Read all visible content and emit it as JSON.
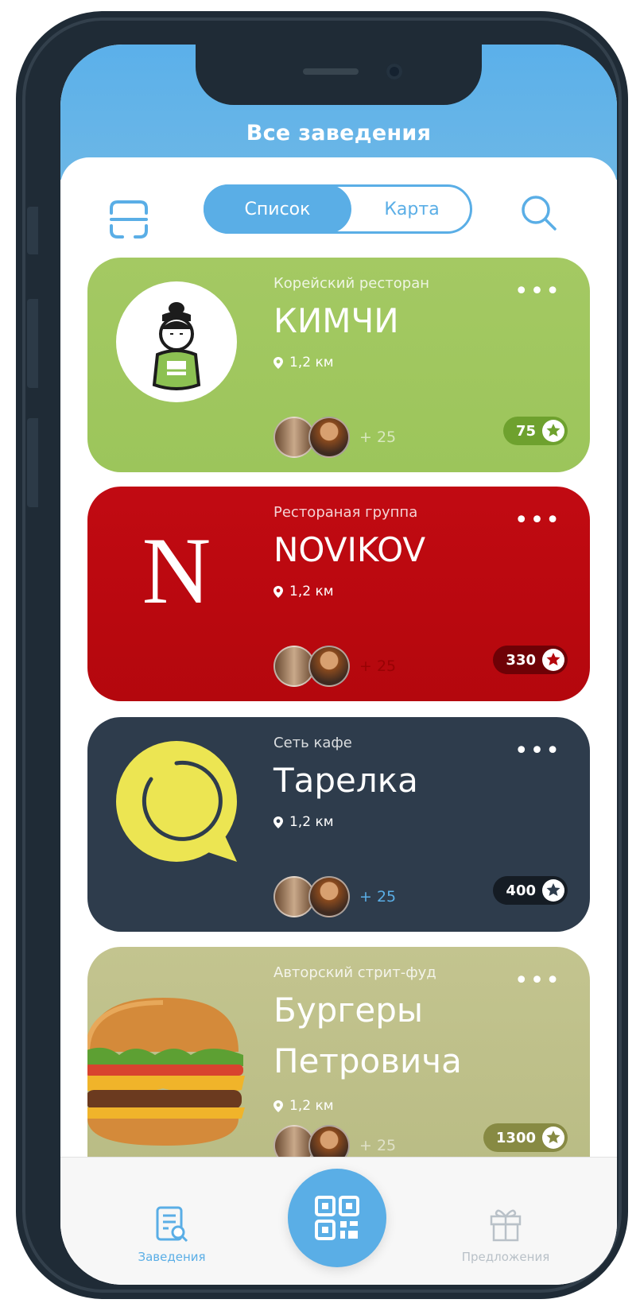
{
  "header": {
    "title": "Все заведения"
  },
  "toolbar": {
    "scan_icon": "scan-frame-icon",
    "tabs": [
      {
        "label": "Список",
        "active": true
      },
      {
        "label": "Карта",
        "active": false
      }
    ],
    "search_icon": "search-icon"
  },
  "cards": [
    {
      "subtitle": "Корейский ресторан",
      "name": "КИМЧИ",
      "distance": "1,2 км",
      "more": "•••",
      "friends_extra": "+ 25",
      "points": "75",
      "color": "#9ec65e",
      "badge_color": "#6ea12e"
    },
    {
      "subtitle": "Ресторaная группа",
      "name": "NOVIKOV",
      "distance": "1,2 км",
      "more": "•••",
      "friends_extra": "+ 25",
      "points": "330",
      "color": "#bb0810",
      "badge_color": "#6e0106",
      "logo_letter": "N"
    },
    {
      "subtitle": "Сеть кафе",
      "name": "Тарелка",
      "distance": "1,2 км",
      "more": "•••",
      "friends_extra": "+ 25",
      "points": "400",
      "color": "#2e3c4c",
      "badge_color": "#151c24"
    },
    {
      "subtitle": "Авторский стрит-фуд",
      "name_line1": "Бургеры",
      "name_line2": "Петровича",
      "distance": "1,2 км",
      "more": "•••",
      "friends_extra": "+ 25",
      "points": "1300",
      "color": "#bfc08b",
      "badge_color": "#878a43"
    }
  ],
  "tabbar": {
    "left": {
      "label": "Заведения",
      "icon": "list-search-icon",
      "color": "#5aaee6"
    },
    "center": {
      "icon": "qr-code-icon"
    },
    "right": {
      "label": "Предложения",
      "icon": "gift-icon",
      "color": "#b9c1c8"
    }
  }
}
